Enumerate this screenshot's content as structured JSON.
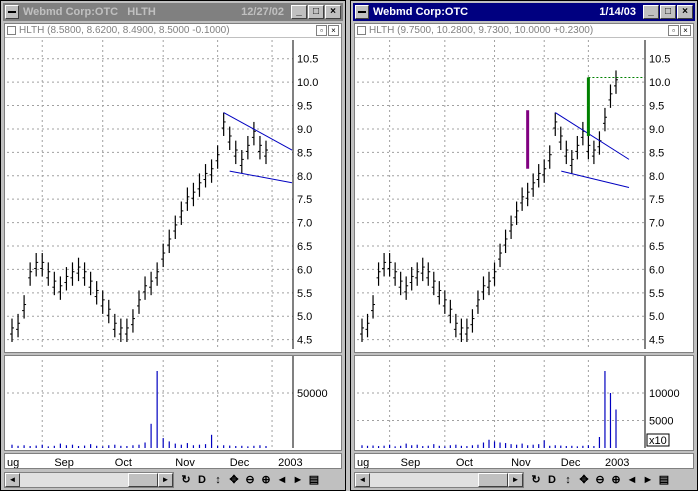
{
  "left": {
    "window_title": "Webmd Corp:OTC   HLTH",
    "date": "12/27/02",
    "sub_title": "HLTH (8.5800, 8.6200, 8.4900, 8.5000 -0.1000)",
    "price_ticks": [
      "10.5",
      "10.0",
      "9.5",
      "9.0",
      "8.5",
      "8.0",
      "7.5",
      "7.0",
      "6.5",
      "6.0",
      "5.5",
      "5.0",
      "4.5"
    ],
    "volume_ticks": [
      "50000"
    ],
    "months": [
      "ug",
      "Sep",
      "Oct",
      "Nov",
      "Dec",
      "2003"
    ]
  },
  "right": {
    "window_title": "Webmd Corp:OTC",
    "date": "1/14/03",
    "sub_title": "HLTH (9.7500, 10.2800, 9.7300, 10.0000 +0.2300)",
    "price_ticks": [
      "10.5",
      "10.0",
      "9.5",
      "9.0",
      "8.5",
      "8.0",
      "7.5",
      "7.0",
      "6.5",
      "6.0",
      "5.5",
      "5.0",
      "4.5"
    ],
    "volume_ticks": [
      "10000",
      "5000"
    ],
    "volume_multiplier": "x10",
    "months": [
      "ug",
      "Sep",
      "Oct",
      "Nov",
      "Dec",
      "2003"
    ]
  },
  "toolbar": {
    "refresh_icon": "↻",
    "d_label": "D",
    "move_icon": "↕",
    "pan_icon": "✥",
    "zoom_out_icon": "⊖",
    "zoom_in_icon": "⊕",
    "prev_icon": "◄",
    "next_icon": "►",
    "page_icon": "▤"
  },
  "colors": {
    "bars": "#000000",
    "trendline": "#0000c0",
    "volume": "#0000c0",
    "grid": "#a0a0a0",
    "flag_purple": "#800080",
    "flag_green": "#008000"
  },
  "chart_data": [
    {
      "type": "bar",
      "panel": "left",
      "title": "HLTH",
      "ylim": [
        4.3,
        10.9
      ],
      "volume_ylim": [
        0,
        80000
      ],
      "ohlc_close": [
        4.7,
        4.8,
        5.2,
        5.9,
        6.1,
        6.1,
        5.9,
        5.7,
        5.6,
        5.8,
        5.9,
        6.0,
        5.9,
        5.7,
        5.5,
        5.3,
        5.1,
        4.8,
        4.7,
        4.7,
        4.9,
        5.3,
        5.6,
        5.7,
        5.9,
        6.3,
        6.6,
        6.9,
        7.2,
        7.5,
        7.6,
        7.8,
        8.0,
        8.1,
        8.4,
        9.1,
        8.8,
        8.5,
        8.3,
        8.6,
        8.9,
        8.6,
        8.5
      ],
      "volume": [
        3000,
        2000,
        2500,
        1800,
        2200,
        3000,
        1500,
        2000,
        4000,
        2500,
        3000,
        1800,
        2200,
        3500,
        2000,
        1500,
        2500,
        3000,
        2000,
        1800,
        2500,
        3000,
        5000,
        22000,
        70000,
        9000,
        6000,
        4000,
        3000,
        4500,
        2500,
        3000,
        3500,
        12000,
        2000,
        2500,
        2200,
        1800,
        2000,
        1500,
        2000,
        2500,
        1800
      ]
    },
    {
      "type": "bar",
      "panel": "right",
      "title": "HLTH",
      "ylim": [
        4.3,
        10.9
      ],
      "volume_ylim": [
        0,
        16000
      ],
      "ohlc_close": [
        4.7,
        4.8,
        5.2,
        5.9,
        6.1,
        6.1,
        5.9,
        5.7,
        5.6,
        5.8,
        5.9,
        6.0,
        5.9,
        5.7,
        5.5,
        5.3,
        5.1,
        4.8,
        4.7,
        4.7,
        4.9,
        5.3,
        5.6,
        5.7,
        5.9,
        6.3,
        6.6,
        6.9,
        7.2,
        7.5,
        7.6,
        7.8,
        8.0,
        8.1,
        8.4,
        9.1,
        8.8,
        8.5,
        8.3,
        8.6,
        8.9,
        8.6,
        8.5,
        8.7,
        9.2,
        9.7,
        10.0
      ],
      "volume": [
        500,
        400,
        450,
        350,
        420,
        600,
        300,
        400,
        800,
        500,
        600,
        350,
        420,
        700,
        400,
        300,
        500,
        600,
        400,
        350,
        500,
        600,
        1000,
        1500,
        1200,
        1000,
        900,
        700,
        600,
        800,
        500,
        600,
        700,
        1400,
        400,
        500,
        440,
        360,
        400,
        300,
        400,
        500,
        360,
        2000,
        14000,
        10000,
        7000
      ]
    }
  ]
}
